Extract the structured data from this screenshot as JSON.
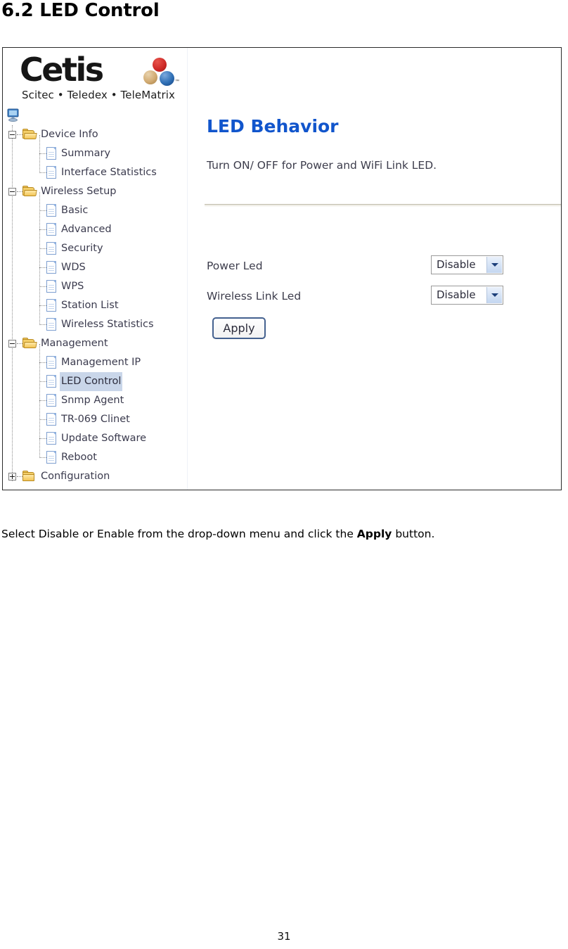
{
  "document": {
    "heading": "6.2 LED Control",
    "caption_before": "Select Disable or Enable from the drop-down menu and click the ",
    "caption_bold": "Apply",
    "caption_after": " button.",
    "page_number": "31"
  },
  "logo": {
    "wordmark": "Cetis",
    "trademark": "™",
    "tagline": "Scitec • Teledex • TeleMatrix",
    "dot_colors": [
      "#cf2b28",
      "#d2ab72",
      "#2f6fb5"
    ]
  },
  "nav": {
    "root_icon": "computer-icon",
    "items": [
      {
        "label": "Device Info",
        "level": 0,
        "icon": "folder-open-icon",
        "expander": "minus",
        "selected": false
      },
      {
        "label": "Summary",
        "level": 1,
        "icon": "page-icon",
        "expander": null,
        "selected": false
      },
      {
        "label": "Interface Statistics",
        "level": 1,
        "icon": "page-icon",
        "expander": null,
        "selected": false
      },
      {
        "label": "Wireless Setup",
        "level": 0,
        "icon": "folder-open-icon",
        "expander": "minus",
        "selected": false
      },
      {
        "label": "Basic",
        "level": 1,
        "icon": "page-icon",
        "expander": null,
        "selected": false
      },
      {
        "label": "Advanced",
        "level": 1,
        "icon": "page-icon",
        "expander": null,
        "selected": false
      },
      {
        "label": "Security",
        "level": 1,
        "icon": "page-icon",
        "expander": null,
        "selected": false
      },
      {
        "label": "WDS",
        "level": 1,
        "icon": "page-icon",
        "expander": null,
        "selected": false
      },
      {
        "label": "WPS",
        "level": 1,
        "icon": "page-icon",
        "expander": null,
        "selected": false
      },
      {
        "label": "Station List",
        "level": 1,
        "icon": "page-icon",
        "expander": null,
        "selected": false
      },
      {
        "label": "Wireless Statistics",
        "level": 1,
        "icon": "page-icon",
        "expander": null,
        "selected": false
      },
      {
        "label": "Management",
        "level": 0,
        "icon": "folder-open-icon",
        "expander": "minus",
        "selected": false
      },
      {
        "label": "Management IP",
        "level": 1,
        "icon": "page-icon",
        "expander": null,
        "selected": false
      },
      {
        "label": "LED Control",
        "level": 1,
        "icon": "page-icon",
        "expander": null,
        "selected": true
      },
      {
        "label": "Snmp Agent",
        "level": 1,
        "icon": "page-icon",
        "expander": null,
        "selected": false
      },
      {
        "label": "TR-069 Clinet",
        "level": 1,
        "icon": "page-icon",
        "expander": null,
        "selected": false
      },
      {
        "label": "Update Software",
        "level": 1,
        "icon": "page-icon",
        "expander": null,
        "selected": false
      },
      {
        "label": "Reboot",
        "level": 1,
        "icon": "page-icon",
        "expander": null,
        "selected": false
      },
      {
        "label": "Configuration",
        "level": 0,
        "icon": "folder-closed-icon",
        "expander": "plus",
        "selected": false
      }
    ],
    "selected_highlight_color": "#c9d6e9"
  },
  "panel": {
    "title": "LED Behavior",
    "title_color": "#1155cc",
    "subtitle": "Turn ON/ OFF for Power and WiFi Link LED.",
    "fields": [
      {
        "label": "Power Led",
        "value": "Disable",
        "options": [
          "Disable",
          "Enable"
        ]
      },
      {
        "label": "Wireless Link Led",
        "value": "Disable",
        "options": [
          "Disable",
          "Enable"
        ]
      }
    ],
    "apply_label": "Apply"
  }
}
